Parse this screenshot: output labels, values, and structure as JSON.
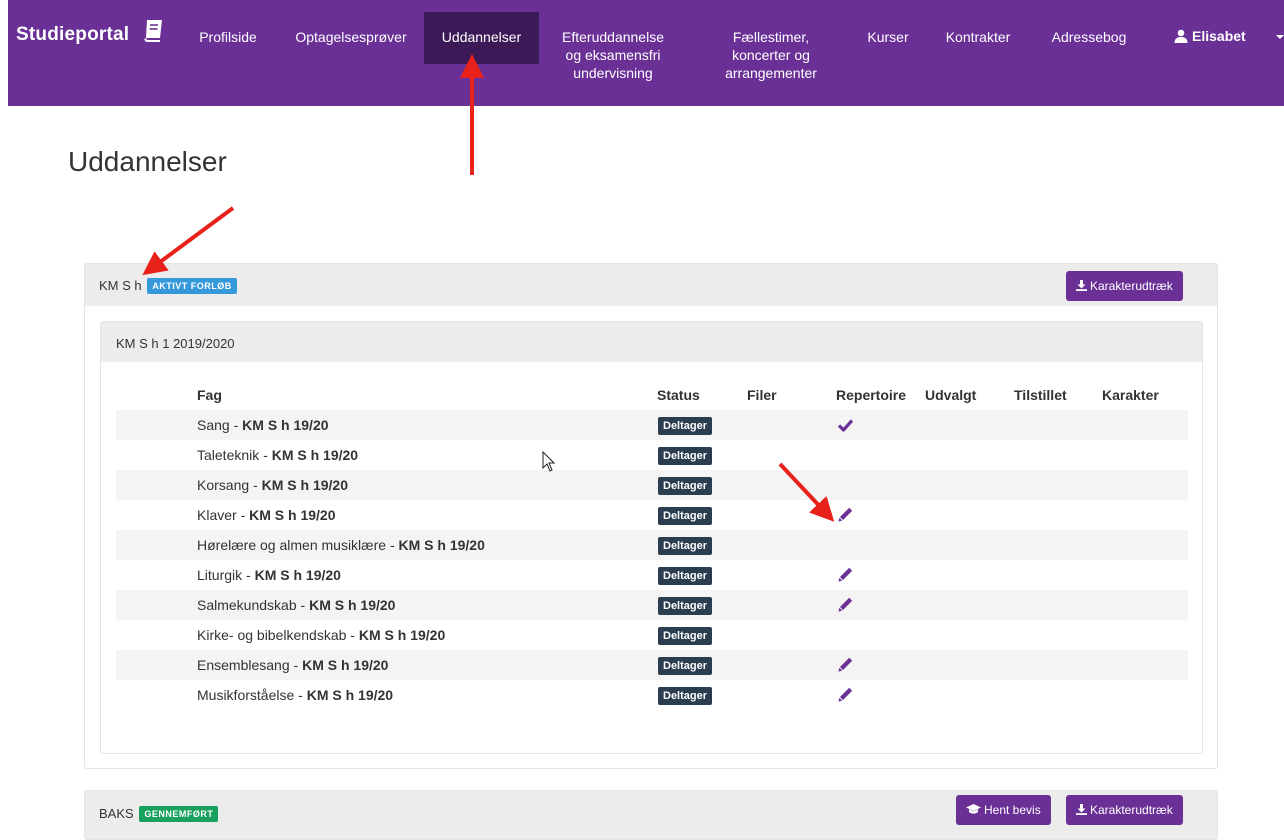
{
  "navbar": {
    "brand": "Studieportal",
    "items": [
      {
        "label": "Profilside"
      },
      {
        "label": "Optagelsesprøver"
      },
      {
        "label": "Uddannelser"
      },
      {
        "line1": "Efteruddannelse",
        "line2": "og eksamensfri",
        "line3": "undervisning"
      },
      {
        "line1": "Fællestimer,",
        "line2": "koncerter og",
        "line3": "arrangementer"
      },
      {
        "label": "Kurser"
      },
      {
        "label": "Kontrakter"
      },
      {
        "label": "Adressebog"
      }
    ],
    "user": "Elisabet"
  },
  "page": {
    "title": "Uddannelser"
  },
  "programs": [
    {
      "name": "KM S h",
      "badge": "AKTIVT FORLØB",
      "badge_color": "#3498db",
      "button_karakter": "Karakterudtræk",
      "year_title": "KM S h 1 2019/2020",
      "columns": [
        "Fag",
        "Status",
        "Filer",
        "Repertoire",
        "Udvalgt",
        "Tilstillet",
        "Karakter"
      ],
      "rows": [
        {
          "fag": "Sang",
          "code": "KM S h 19/20",
          "status": "Deltager",
          "repertoire": "check-icon"
        },
        {
          "fag": "Taleteknik",
          "code": "KM S h 19/20",
          "status": "Deltager",
          "repertoire": ""
        },
        {
          "fag": "Korsang",
          "code": "KM S h 19/20",
          "status": "Deltager",
          "repertoire": ""
        },
        {
          "fag": "Klaver",
          "code": "KM S h 19/20",
          "status": "Deltager",
          "repertoire": "pencil-icon"
        },
        {
          "fag": "Hørelære og almen musiklære",
          "code": "KM S h 19/20",
          "status": "Deltager",
          "repertoire": ""
        },
        {
          "fag": "Liturgik",
          "code": "KM S h 19/20",
          "status": "Deltager",
          "repertoire": "pencil-icon"
        },
        {
          "fag": "Salmekundskab",
          "code": "KM S h 19/20",
          "status": "Deltager",
          "repertoire": "pencil-icon"
        },
        {
          "fag": "Kirke- og bibelkendskab",
          "code": "KM S h 19/20",
          "status": "Deltager",
          "repertoire": ""
        },
        {
          "fag": "Ensemblesang",
          "code": "KM S h 19/20",
          "status": "Deltager",
          "repertoire": "pencil-icon"
        },
        {
          "fag": "Musikforståelse",
          "code": "KM S h 19/20",
          "status": "Deltager",
          "repertoire": "pencil-icon"
        }
      ]
    },
    {
      "name": "BAKS",
      "badge": "GENNEMFØRT",
      "badge_color": "#18a05e",
      "button_bevis": "Hent bevis",
      "button_karakter": "Karakterudtræk"
    }
  ],
  "colors": {
    "brand": "#6a3096",
    "nav_active": "#3c1a57",
    "status_badge": "#2b3e50",
    "annotation": "#e8221b"
  }
}
